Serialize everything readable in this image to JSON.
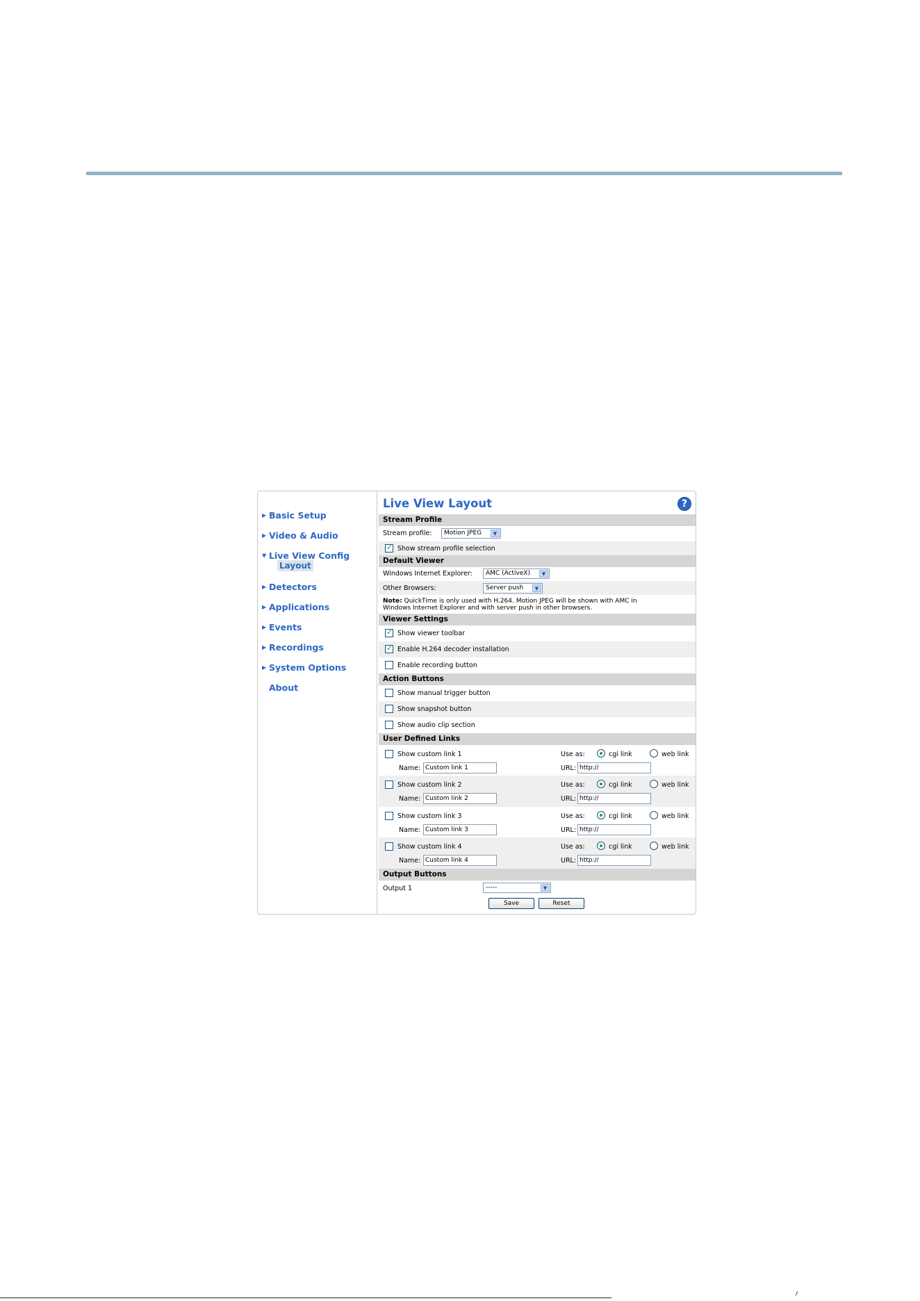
{
  "sidebar": {
    "items": [
      {
        "label": "Basic Setup",
        "arrow": "right"
      },
      {
        "label": "Video & Audio",
        "arrow": "right"
      },
      {
        "label": "Live View Config",
        "arrow": "down"
      },
      {
        "label": "Detectors",
        "arrow": "right"
      },
      {
        "label": "Applications",
        "arrow": "right"
      },
      {
        "label": "Events",
        "arrow": "right"
      },
      {
        "label": "Recordings",
        "arrow": "right"
      },
      {
        "label": "System Options",
        "arrow": "right"
      },
      {
        "label": "About",
        "arrow": "none"
      }
    ],
    "sub_item": "Layout"
  },
  "page": {
    "title": "Live View Layout",
    "help_icon": "?"
  },
  "stream_profile": {
    "heading": "Stream Profile",
    "profile_label": "Stream profile:",
    "profile_value": "Motion JPEG",
    "show_selection_label": "Show stream profile selection",
    "show_selection_checked": true
  },
  "default_viewer": {
    "heading": "Default Viewer",
    "ie_label": "Windows Internet Explorer:",
    "ie_value": "AMC (ActiveX)",
    "other_label": "Other Browsers:",
    "other_value": "Server push",
    "note_bold": "Note:",
    "note_line1": "QuickTime is only used with H.264. Motion JPEG will be shown with AMC in",
    "note_line2": "Windows Internet Explorer and with server push in other browsers."
  },
  "viewer_settings": {
    "heading": "Viewer Settings",
    "options": [
      {
        "label": "Show viewer toolbar",
        "checked": true
      },
      {
        "label": "Enable H.264 decoder installation",
        "checked": true
      },
      {
        "label": "Enable recording button",
        "checked": false
      }
    ]
  },
  "action_buttons": {
    "heading": "Action Buttons",
    "options": [
      {
        "label": "Show manual trigger button",
        "checked": false
      },
      {
        "label": "Show snapshot button",
        "checked": false
      },
      {
        "label": "Show audio clip section",
        "checked": false
      }
    ]
  },
  "user_links": {
    "heading": "User Defined Links",
    "use_as_label": "Use as:",
    "cgi_label": "cgi link",
    "web_label": "web link",
    "name_label": "Name:",
    "url_label": "URL:",
    "links": [
      {
        "label": "Show custom link 1",
        "name": "Custom link 1",
        "url": "http://",
        "checked": false,
        "mode": "cgi"
      },
      {
        "label": "Show custom link 2",
        "name": "Custom link 2",
        "url": "http://",
        "checked": false,
        "mode": "cgi"
      },
      {
        "label": "Show custom link 3",
        "name": "Custom link 3",
        "url": "http://",
        "checked": false,
        "mode": "cgi"
      },
      {
        "label": "Show custom link 4",
        "name": "Custom link 4",
        "url": "http://",
        "checked": false,
        "mode": "cgi"
      }
    ]
  },
  "output_buttons": {
    "heading": "Output Buttons",
    "output_label": "Output 1",
    "output_value": "-----"
  },
  "buttons": {
    "save": "Save",
    "reset": "Reset"
  },
  "colors": {
    "accent": "#2d68c4",
    "section_bg": "#d5d5d5",
    "alt_row_bg": "#efefef",
    "rule": "#8fb5c6",
    "check": "#21a121"
  }
}
